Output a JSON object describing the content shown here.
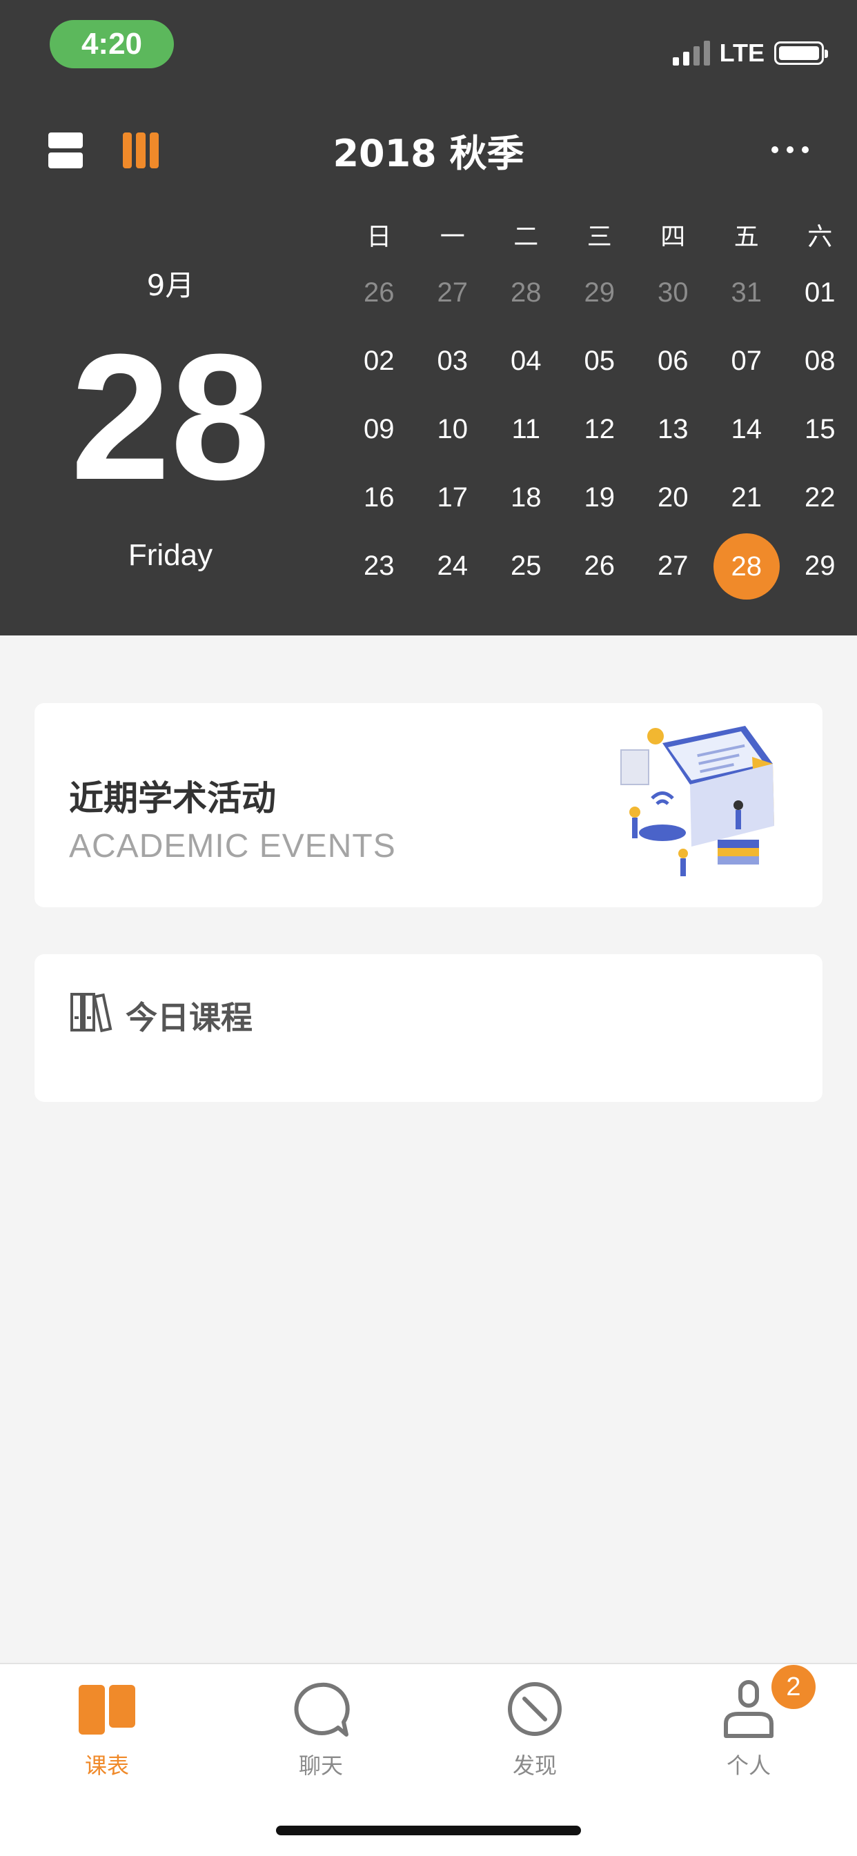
{
  "status_bar": {
    "time": "4:20",
    "network": "LTE"
  },
  "header": {
    "title": "2018 秋季",
    "month": "9月",
    "day": "28",
    "weekday": "Friday"
  },
  "calendar": {
    "weekday_headers": [
      "日",
      "一",
      "二",
      "三",
      "四",
      "五",
      "六"
    ],
    "weeks": [
      [
        "26",
        "27",
        "28",
        "29",
        "30",
        "31",
        "01"
      ],
      [
        "02",
        "03",
        "04",
        "05",
        "06",
        "07",
        "08"
      ],
      [
        "09",
        "10",
        "11",
        "12",
        "13",
        "14",
        "15"
      ],
      [
        "16",
        "17",
        "18",
        "19",
        "20",
        "21",
        "22"
      ],
      [
        "23",
        "24",
        "25",
        "26",
        "27",
        "28",
        "29"
      ]
    ],
    "other_month_days_in_first_week": 6,
    "selected": "28"
  },
  "events_card": {
    "title": "近期学术活动",
    "subtitle": "ACADEMIC EVENTS"
  },
  "courses_card": {
    "title": "今日课程"
  },
  "tabbar": {
    "items": [
      {
        "label": "课表",
        "icon": "schedule-icon",
        "active": true
      },
      {
        "label": "聊天",
        "icon": "chat-bubble-icon",
        "active": false
      },
      {
        "label": "发现",
        "icon": "compass-icon",
        "active": false
      },
      {
        "label": "个人",
        "icon": "person-icon",
        "active": false
      }
    ],
    "profile_badge": "2"
  },
  "colors": {
    "header_bg": "#3b3b3b",
    "accent": "#f08a2a",
    "time_pill": "#5cb85c",
    "page_bg": "#f4f4f4"
  }
}
